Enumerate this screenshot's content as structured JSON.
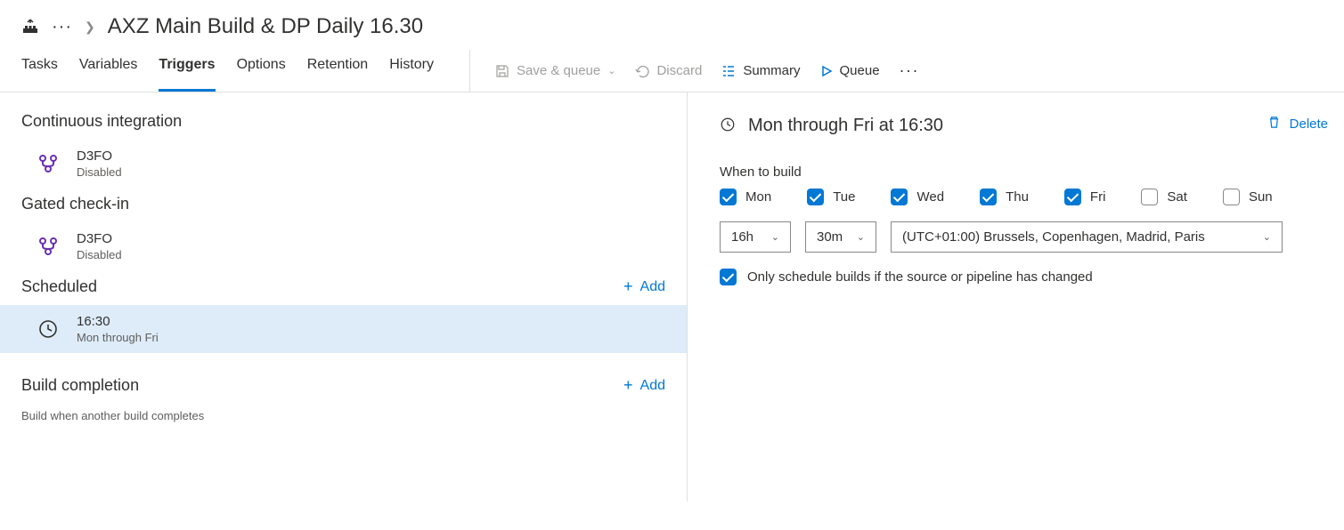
{
  "breadcrumb": {
    "title": "AXZ Main Build & DP Daily 16.30"
  },
  "tabs": [
    {
      "id": "tasks",
      "label": "Tasks",
      "active": false
    },
    {
      "id": "variables",
      "label": "Variables",
      "active": false
    },
    {
      "id": "triggers",
      "label": "Triggers",
      "active": true
    },
    {
      "id": "options",
      "label": "Options",
      "active": false
    },
    {
      "id": "retention",
      "label": "Retention",
      "active": false
    },
    {
      "id": "history",
      "label": "History",
      "active": false
    }
  ],
  "toolbar": {
    "save_queue": "Save & queue",
    "discard": "Discard",
    "summary": "Summary",
    "queue": "Queue"
  },
  "left": {
    "ci": {
      "heading": "Continuous integration",
      "item": {
        "name": "D3FO",
        "status": "Disabled"
      }
    },
    "gated": {
      "heading": "Gated check-in",
      "item": {
        "name": "D3FO",
        "status": "Disabled"
      }
    },
    "scheduled": {
      "heading": "Scheduled",
      "add_label": "Add",
      "item": {
        "time": "16:30",
        "days": "Mon through Fri"
      }
    },
    "completion": {
      "heading": "Build completion",
      "add_label": "Add",
      "help": "Build when another build completes"
    }
  },
  "right": {
    "title": "Mon through Fri at 16:30",
    "delete": "Delete",
    "when_label": "When to build",
    "days": [
      {
        "code": "mon",
        "label": "Mon",
        "checked": true
      },
      {
        "code": "tue",
        "label": "Tue",
        "checked": true
      },
      {
        "code": "wed",
        "label": "Wed",
        "checked": true
      },
      {
        "code": "thu",
        "label": "Thu",
        "checked": true
      },
      {
        "code": "fri",
        "label": "Fri",
        "checked": true
      },
      {
        "code": "sat",
        "label": "Sat",
        "checked": false
      },
      {
        "code": "sun",
        "label": "Sun",
        "checked": false
      }
    ],
    "hour": "16h",
    "minute": "30m",
    "timezone": "(UTC+01:00) Brussels, Copenhagen, Madrid, Paris",
    "only_changed": {
      "checked": true,
      "label": "Only schedule builds if the source or pipeline has changed"
    }
  }
}
